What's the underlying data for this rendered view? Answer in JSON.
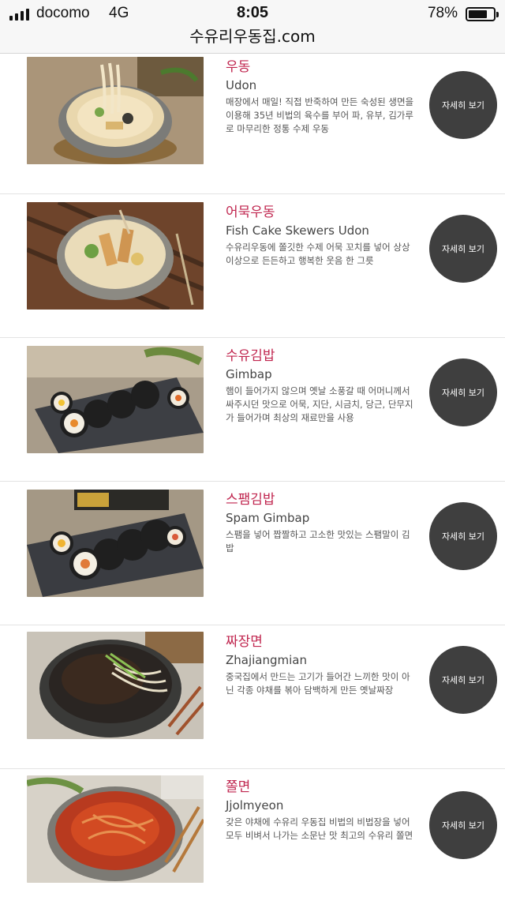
{
  "status_bar": {
    "carrier": "docomo",
    "network": "4G",
    "time": "8:05",
    "battery_percent": "78%",
    "battery_level": 0.78
  },
  "url_bar": {
    "url": "수유리우동집.com"
  },
  "menu": {
    "items": [
      {
        "name_ko": "우동",
        "name_en": "Udon",
        "description": "매장에서 매일! 직접 반죽하여 만든 숙성된 생면을 이용해 35년 비법의 육수를 부어 파, 유부, 김가루로 마무리한 정통 수제 우동",
        "button_label": "자세히 보기",
        "photo_icon": "udon-photo"
      },
      {
        "name_ko": "어묵우동",
        "name_en": "Fish Cake Skewers Udon",
        "description": "수유리우동에 쫄깃한 수제 어묵 꼬치를 넣어 상상 이상으로 든든하고 행복한 웃음 한 그릇",
        "button_label": "자세히 보기",
        "photo_icon": "fish-cake-udon-photo"
      },
      {
        "name_ko": "수유김밥",
        "name_en": "Gimbap",
        "description": "햄이 들어가지 않으며 옛날 소풍갈 때 어머니께서 싸주시던 맛으로 어묵, 지단, 시금치, 당근, 단무지가 들어가며 최상의 재료만을 사용",
        "button_label": "자세히 보기",
        "photo_icon": "gimbap-photo"
      },
      {
        "name_ko": "스팸김밥",
        "name_en": "Spam Gimbap",
        "description": "스팸을 넣어 짭짤하고 고소한 맛있는 스팸말이 김밥",
        "button_label": "자세히 보기",
        "photo_icon": "spam-gimbap-photo"
      },
      {
        "name_ko": "짜장면",
        "name_en": "Zhajiangmian",
        "description": "중국집에서 만드는 고기가 들어간 느끼한 맛이 아닌 각종 야채를 볶아 담백하게 만든 옛날짜장",
        "button_label": "자세히 보기",
        "photo_icon": "zhajiangmian-photo"
      },
      {
        "name_ko": "쫄면",
        "name_en": "Jjolmyeon",
        "description": "갖은 야채에 수유리 우동집 비법의 비법장을 넣어 모두 비벼서 나가는 소문난 맛 최고의 수유리 쫄면",
        "button_label": "자세히 보기",
        "photo_icon": "jjolmyeon-photo"
      }
    ]
  },
  "colors": {
    "accent": "#c0264f",
    "button": "#3f3f3f",
    "divider": "#e3e3e3"
  }
}
